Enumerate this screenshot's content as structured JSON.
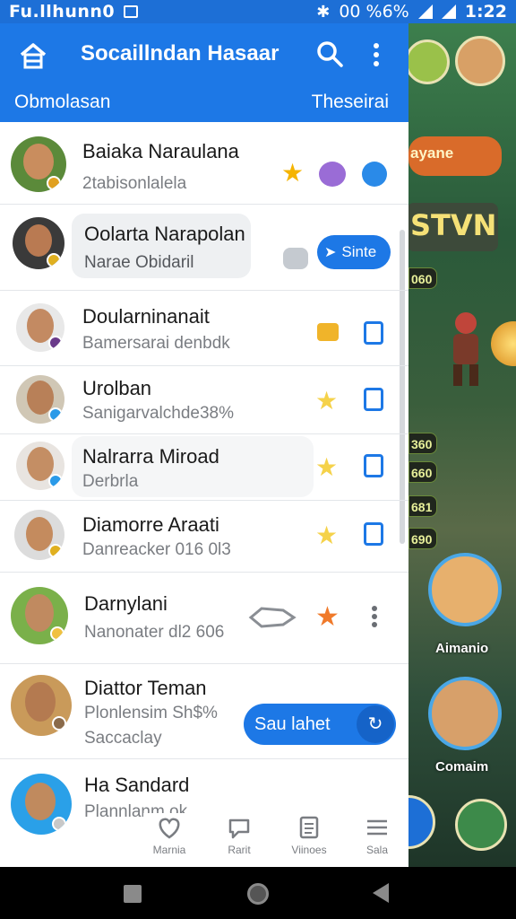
{
  "status_bar": {
    "carrier": "Fu.llhunn0",
    "time": "1:22",
    "battery": "00 %6%"
  },
  "app_bar": {
    "title": "Socaillndan Hasaar",
    "subtitle_left": "Obmolasan",
    "subtitle_right": "Theseirai",
    "icons": [
      "home-icon",
      "search-icon",
      "more-vert-icon"
    ]
  },
  "colors": {
    "accent": "#1d78e6",
    "divider": "#e3e6ea",
    "subtext": "#7a7d82"
  },
  "contacts": [
    {
      "name": "Baiaka Naraulana",
      "sub": "2tabisonlalela",
      "icons": [
        "star-icon",
        "bear-icon",
        "chat-bubble-icon"
      ]
    },
    {
      "name": "Oolarta Narapolan",
      "sub": "Narae Obidaril",
      "icons": [
        "koala-icon"
      ],
      "button": "Sinte"
    },
    {
      "name": "Doularninanait",
      "sub": "Bamersarai denbdk",
      "icons": [
        "envelope-icon",
        "contact-card-icon"
      ]
    },
    {
      "name": "Urolban",
      "sub": "Sanigarvalchde38%",
      "icons": [
        "star-icon",
        "contact-card-icon"
      ]
    },
    {
      "name": "Nalrarra Miroad",
      "sub": "Derbrla",
      "icons": [
        "star-icon",
        "contact-card-icon"
      ]
    },
    {
      "name": "Diamorre Araati",
      "sub": "Danreacker 016 0l3",
      "icons": [
        "star-icon",
        "contact-card-icon"
      ]
    },
    {
      "name": "Darnylani",
      "sub": "Nanonater dl2 606",
      "icons": [
        "fish-icon",
        "star-icon",
        "more-vert-icon"
      ]
    },
    {
      "name": "Diattor Teman",
      "sub": "Plonlensim Sh$%",
      "sub2": "Saccaclay",
      "button": "Sau lahet"
    },
    {
      "name": "Ha Sandard",
      "sub": "Plannlanm ok"
    }
  ],
  "bottom_tabs": [
    {
      "label": "Marnia",
      "icon": "heart-icon"
    },
    {
      "label": "Rarit",
      "icon": "chat-icon"
    },
    {
      "label": "Viinoes",
      "icon": "document-icon"
    },
    {
      "label": "Sala",
      "icon": "menu-icon"
    }
  ],
  "game": {
    "pill_text": "ayane",
    "banner_text": "STVN",
    "scores": [
      "060",
      "360",
      "660",
      "681",
      "690"
    ],
    "player_names": [
      "Aimanio",
      "Comaim"
    ]
  },
  "nav_bar": [
    "recents-button",
    "home-button",
    "back-button"
  ]
}
